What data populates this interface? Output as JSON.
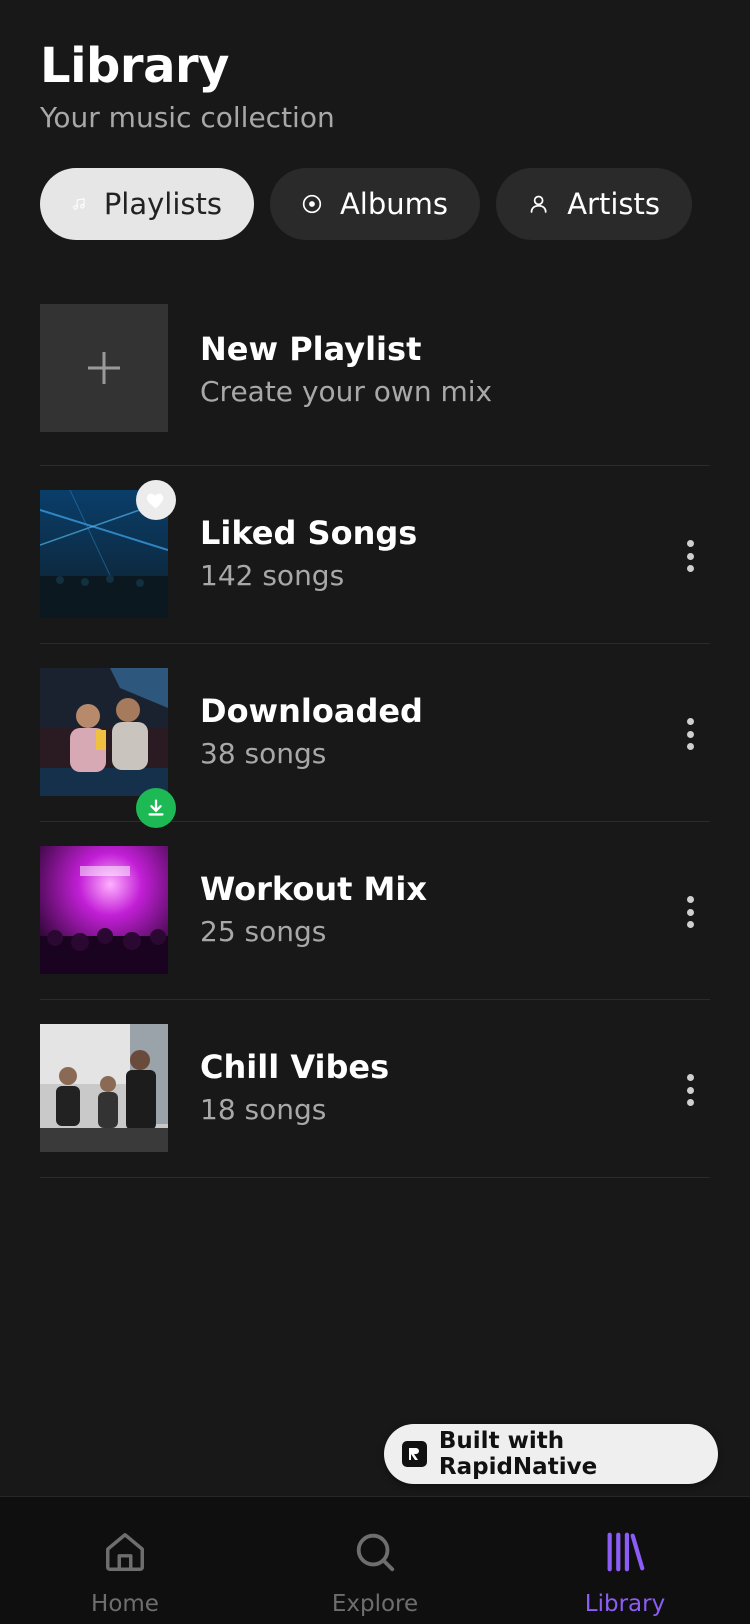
{
  "header": {
    "title": "Library",
    "subtitle": "Your music collection"
  },
  "chips": [
    {
      "label": "Playlists",
      "icon": "music-note-icon",
      "active": true
    },
    {
      "label": "Albums",
      "icon": "disc-icon",
      "active": false
    },
    {
      "label": "Artists",
      "icon": "user-icon",
      "active": false
    }
  ],
  "new_playlist": {
    "title": "New Playlist",
    "subtitle": "Create your own mix"
  },
  "playlists": [
    {
      "title": "Liked Songs",
      "subtitle": "142 songs",
      "badge": "heart-icon"
    },
    {
      "title": "Downloaded",
      "subtitle": "38 songs",
      "badge": "download-icon"
    },
    {
      "title": "Workout Mix",
      "subtitle": "25 songs"
    },
    {
      "title": "Chill Vibes",
      "subtitle": "18 songs"
    }
  ],
  "built_with": "Built with RapidNative",
  "tabs": [
    {
      "label": "Home",
      "icon": "home-icon",
      "active": false
    },
    {
      "label": "Explore",
      "icon": "search-icon",
      "active": false
    },
    {
      "label": "Library",
      "icon": "library-icon",
      "active": true
    }
  ],
  "colors": {
    "accent": "#8b5cf6",
    "download_badge": "#1db954",
    "background": "#181818"
  }
}
